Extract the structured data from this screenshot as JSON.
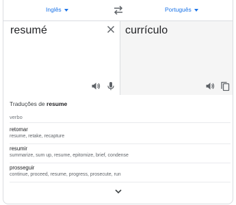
{
  "header": {
    "source_language": "Inglês",
    "target_language": "Português"
  },
  "source": {
    "text": "resumé"
  },
  "target": {
    "text": "currículo"
  },
  "dictionary": {
    "title_prefix": "Traduções de",
    "title_word": "resume",
    "part_of_speech": "verbo",
    "entries": [
      {
        "word": "retomar",
        "synonyms": "resume, retake, recapture"
      },
      {
        "word": "resumir",
        "synonyms": "summarize, sum up, resume, epitomize, brief, condense"
      },
      {
        "word": "prosseguir",
        "synonyms": "continue, proceed, resume, progress, prosecute, run"
      }
    ]
  },
  "icons": {
    "swap": "swap-arrows-icon",
    "clear": "close-icon",
    "speaker": "speaker-icon",
    "mic": "microphone-icon",
    "copy": "copy-icon",
    "expand": "chevron-down-icon"
  },
  "colors": {
    "accent": "#1a73e8",
    "target_background": "#f5f5f5",
    "icon": "#5f6368"
  }
}
